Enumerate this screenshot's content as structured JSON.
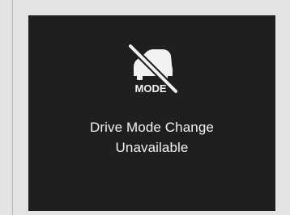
{
  "notification": {
    "icon_name": "drive-mode-unavailable-icon",
    "icon_label": "MODE",
    "message_line1": "Drive Mode Change",
    "message_line2": "Unavailable"
  },
  "colors": {
    "page_background": "#e4e4e4",
    "panel_background": "#1f1f1f",
    "foreground": "#f2f2f2"
  }
}
